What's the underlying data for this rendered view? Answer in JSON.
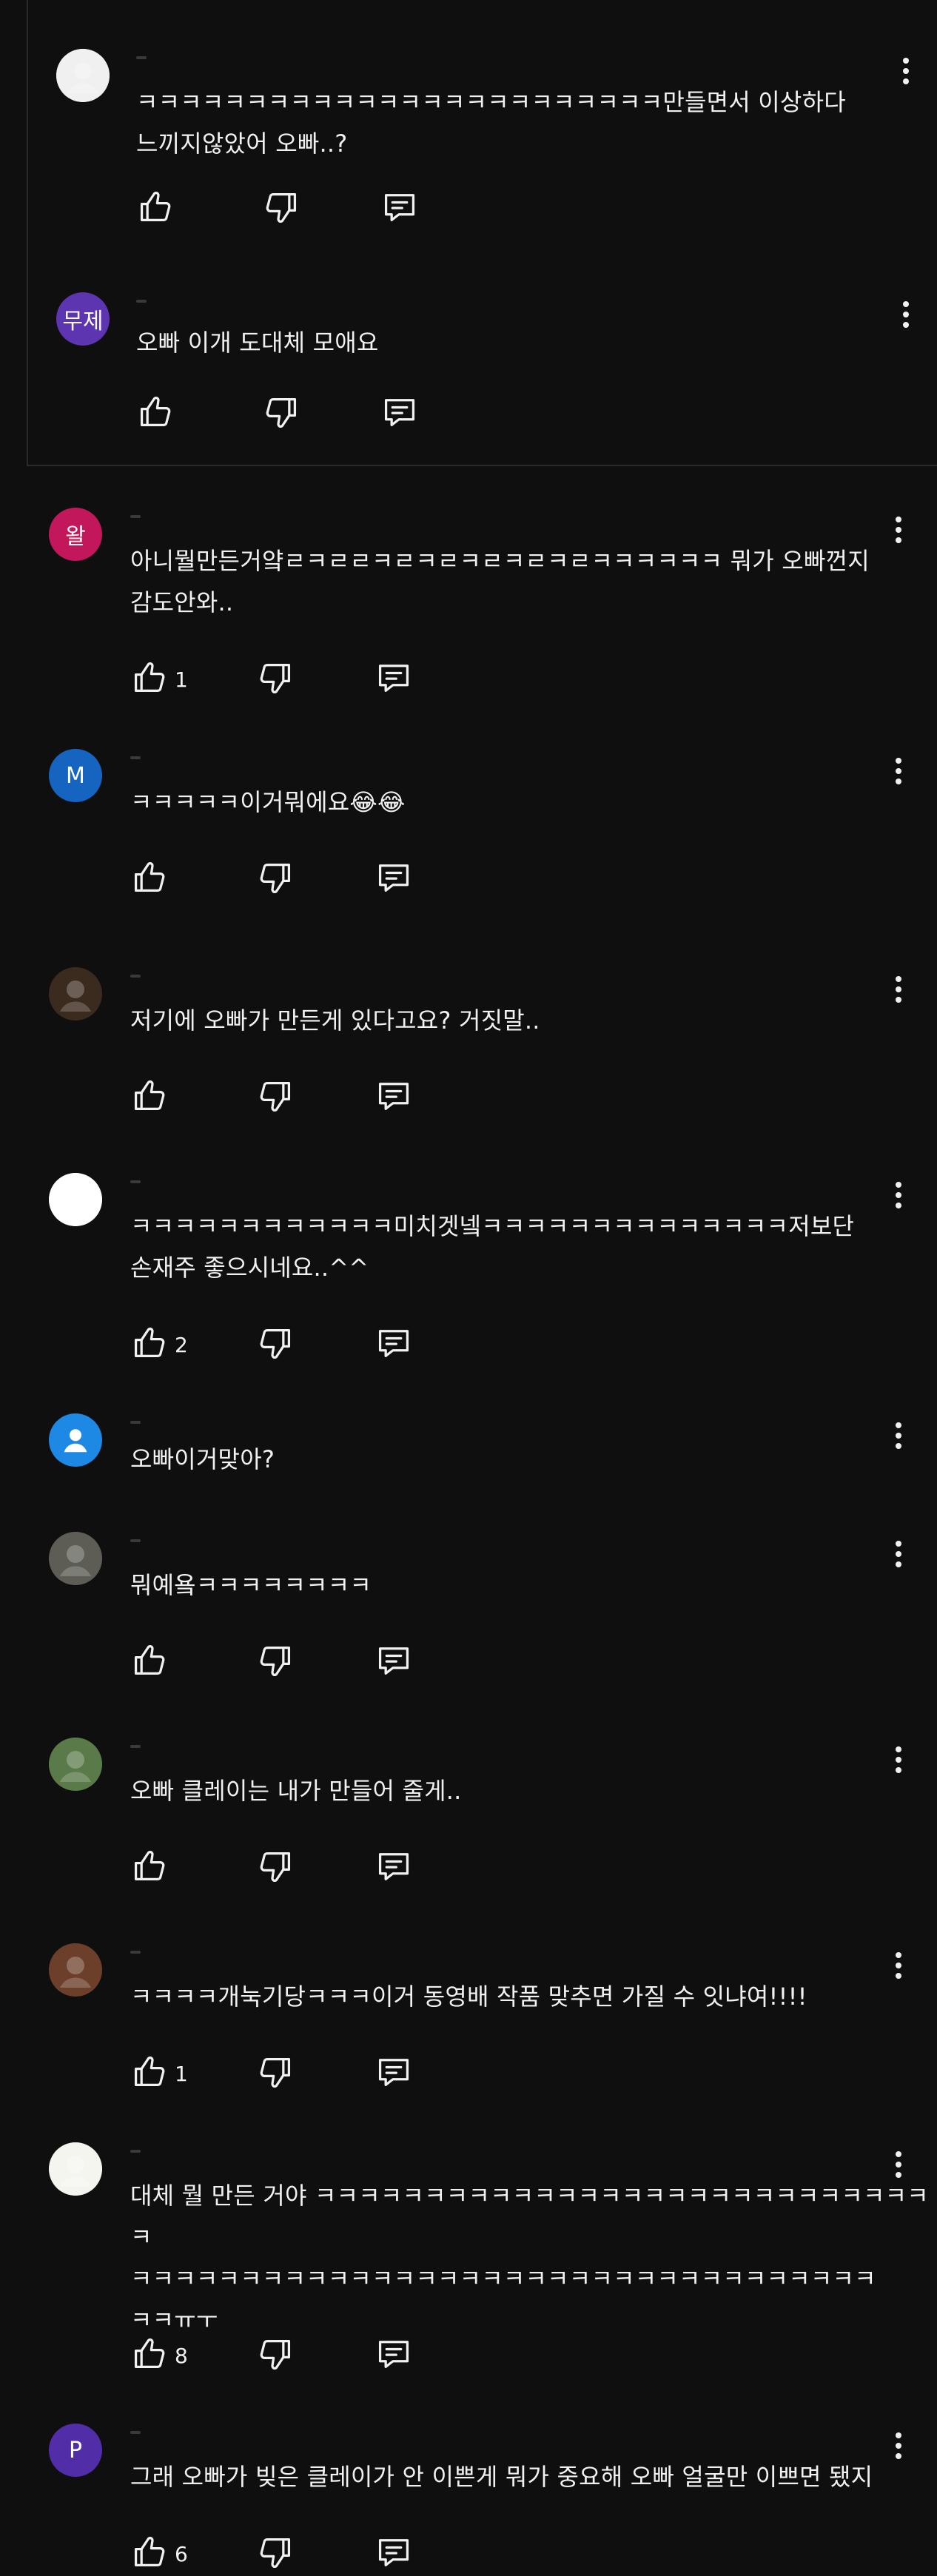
{
  "colors": {
    "background": "#0f0f0f",
    "text": "#f1f1f1",
    "divider": "#2a2a2a"
  },
  "icons": {
    "like": "thumb-up-outline-icon",
    "dislike": "thumb-down-outline-icon",
    "reply": "comment-reply-icon",
    "menu": "more-vert-icon"
  },
  "replies": [
    {
      "avatar": {
        "kind": "image",
        "label": "",
        "color": "#f0f0f0"
      },
      "text": "ㅋㅋㅋㅋㅋㅋㅋㅋㅋㅋㅋㅋㅋㅋㅋㅋㅋㅋㅋㅋㅋㅋㅋㅋ만들면서 이상하다\n느끼지않았어 오빠..?",
      "likes": ""
    },
    {
      "avatar": {
        "kind": "letter",
        "label": "무제",
        "color": "#5e35b1"
      },
      "text": "오빠 이개 도대체 모애요",
      "likes": ""
    }
  ],
  "comments": [
    {
      "avatar": {
        "kind": "letter",
        "label": "왈",
        "color": "#c2185b"
      },
      "text": "아니뭘만든거얔ㄹㅋㄹㄹㅋㄹㅋㄹㅋㄹㅋㄹㅋㄹㅋㅋㅋㅋㅋㅋ 뭐가 오빠껀지\n감도안와..",
      "likes": "1"
    },
    {
      "avatar": {
        "kind": "letter",
        "label": "M",
        "color": "#1565c0"
      },
      "text": "ㅋㅋㅋㅋㅋ이거뭐에요😂😂",
      "likes": ""
    },
    {
      "avatar": {
        "kind": "image",
        "label": "",
        "color": "#3b2a1e"
      },
      "text": "저기에 오빠가 만든게 있다고요? 거짓말..",
      "likes": ""
    },
    {
      "avatar": {
        "kind": "image",
        "label": "",
        "color": "#ffffff"
      },
      "text": "ㅋㅋㅋㅋㅋㅋㅋㅋㅋㅋㅋㅋ미치겟넼ㅋㅋㅋㅋㅋㅋㅋㅋㅋㅋㅋㅋㅋㅋ저보단\n손재주 좋으시네요..^^",
      "likes": "2"
    },
    {
      "avatar": {
        "kind": "default",
        "label": "",
        "color": "#1e88e5"
      },
      "text": "오빠이거맞아?",
      "likes": ""
    },
    {
      "avatar": {
        "kind": "image",
        "label": "",
        "color": "#5d5d55"
      },
      "text": "뭐예욬ㅋㅋㅋㅋㅋㅋㅋㅋ",
      "likes": ""
    },
    {
      "avatar": {
        "kind": "image",
        "label": "",
        "color": "#5a7a4a"
      },
      "text": "오빠 클레이는 내가 만들어 줄게..",
      "likes": ""
    },
    {
      "avatar": {
        "kind": "image",
        "label": "",
        "color": "#6b3f2a"
      },
      "text": "ㅋㅋㅋㅋ개눅기당ㅋㅋㅋ이거 동영배 작품 맞추면 가질 수 잇냐여!!!!",
      "likes": "1"
    },
    {
      "avatar": {
        "kind": "image",
        "label": "",
        "color": "#f5f5f0"
      },
      "text": "대체 뭘 만든 거야 ㅋㅋㅋㅋㅋㅋㅋㅋㅋㅋㅋㅋㅋㅋㅋㅋㅋㅋㅋㅋㅋㅋㅋㅋㅋㅋㅋㅋㅋ\nㅋㅋㅋㅋㅋㅋㅋㅋㅋㅋㅋㅋㅋㅋㅋㅋㅋㅋㅋㅋㅋㅋㅋㅋㅋㅋㅋㅋㅋㅋㅋㅋㅋㅋ\nㅋㅋㅠㅜ",
      "likes": "8"
    },
    {
      "avatar": {
        "kind": "letter",
        "label": "P",
        "color": "#512da8"
      },
      "text": "그래 오빠가 빚은 클레이가 안 이쁜게 뭐가 중요해 오빠 얼굴만 이쁘면 됐지",
      "likes": "6"
    }
  ]
}
